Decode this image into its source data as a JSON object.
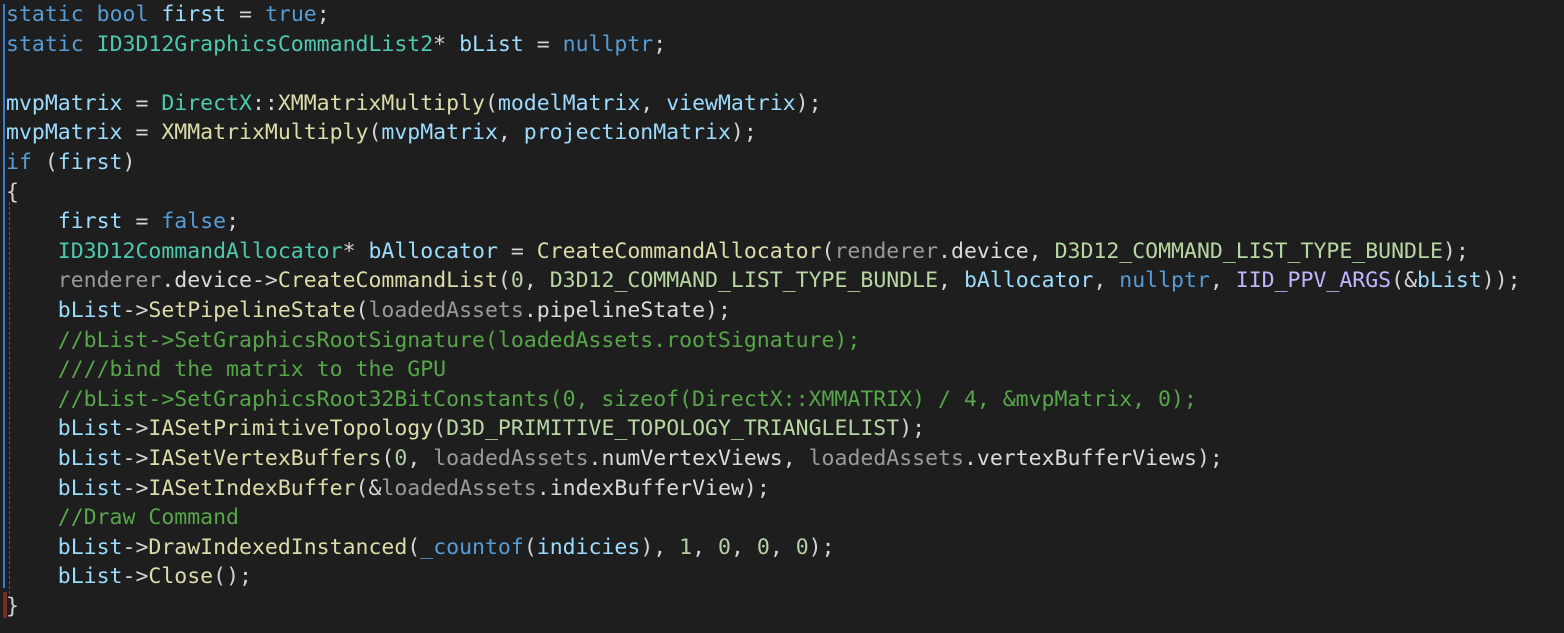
{
  "editor": {
    "language": "cpp",
    "theme": "dark",
    "colors": {
      "background": "#1e1e1e",
      "keyword": "#569cd6",
      "type": "#4ec9b0",
      "function": "#dcdcaa",
      "variable": "#9cdcfe",
      "comment": "#57a64a",
      "number": "#b5cea8",
      "macro": "#beb7ff",
      "margin_change_marker": "#3a7bd5"
    },
    "lines": [
      [
        [
          "kw",
          "static"
        ],
        [
          "op",
          " "
        ],
        [
          "kw",
          "bool"
        ],
        [
          "op",
          " "
        ],
        [
          "var",
          "first"
        ],
        [
          "op",
          " = "
        ],
        [
          "kw",
          "true"
        ],
        [
          "op",
          ";"
        ]
      ],
      [
        [
          "kw",
          "static"
        ],
        [
          "op",
          " "
        ],
        [
          "ty",
          "ID3D12GraphicsCommandList2"
        ],
        [
          "op",
          "* "
        ],
        [
          "var",
          "bList"
        ],
        [
          "op",
          " = "
        ],
        [
          "kw",
          "nullptr"
        ],
        [
          "op",
          ";"
        ]
      ],
      [],
      [
        [
          "var",
          "mvpMatrix"
        ],
        [
          "op",
          " = "
        ],
        [
          "ty",
          "DirectX"
        ],
        [
          "op",
          "::"
        ],
        [
          "fn",
          "XMMatrixMultiply"
        ],
        [
          "op",
          "("
        ],
        [
          "var",
          "modelMatrix"
        ],
        [
          "op",
          ", "
        ],
        [
          "var",
          "viewMatrix"
        ],
        [
          "op",
          ");"
        ]
      ],
      [
        [
          "var",
          "mvpMatrix"
        ],
        [
          "op",
          " = "
        ],
        [
          "fn",
          "XMMatrixMultiply"
        ],
        [
          "op",
          "("
        ],
        [
          "var",
          "mvpMatrix"
        ],
        [
          "op",
          ", "
        ],
        [
          "var",
          "projectionMatrix"
        ],
        [
          "op",
          ");"
        ]
      ],
      [
        [
          "kw",
          "if"
        ],
        [
          "op",
          " ("
        ],
        [
          "var",
          "first"
        ],
        [
          "op",
          ")"
        ]
      ],
      [
        [
          "op",
          "{"
        ]
      ],
      [
        [
          "op",
          "    "
        ],
        [
          "var",
          "first"
        ],
        [
          "op",
          " = "
        ],
        [
          "kw",
          "false"
        ],
        [
          "op",
          ";"
        ]
      ],
      [
        [
          "op",
          "    "
        ],
        [
          "ty",
          "ID3D12CommandAllocator"
        ],
        [
          "op",
          "* "
        ],
        [
          "var",
          "bAllocator"
        ],
        [
          "op",
          " = "
        ],
        [
          "fn",
          "CreateCommandAllocator"
        ],
        [
          "op",
          "("
        ],
        [
          "dim",
          "renderer"
        ],
        [
          "op",
          "."
        ],
        [
          "mem",
          "device"
        ],
        [
          "op",
          ", "
        ],
        [
          "enum",
          "D3D12_COMMAND_LIST_TYPE_BUNDLE"
        ],
        [
          "op",
          ");"
        ]
      ],
      [
        [
          "op",
          "    "
        ],
        [
          "dim",
          "renderer"
        ],
        [
          "op",
          "."
        ],
        [
          "mem",
          "device"
        ],
        [
          "op",
          "->"
        ],
        [
          "fn",
          "CreateCommandList"
        ],
        [
          "op",
          "("
        ],
        [
          "num",
          "0"
        ],
        [
          "op",
          ", "
        ],
        [
          "enum",
          "D3D12_COMMAND_LIST_TYPE_BUNDLE"
        ],
        [
          "op",
          ", "
        ],
        [
          "var",
          "bAllocator"
        ],
        [
          "op",
          ", "
        ],
        [
          "kw",
          "nullptr"
        ],
        [
          "op",
          ", "
        ],
        [
          "mac",
          "IID_PPV_ARGS"
        ],
        [
          "op",
          "(&"
        ],
        [
          "var",
          "bList"
        ],
        [
          "op",
          "));"
        ]
      ],
      [
        [
          "op",
          "    "
        ],
        [
          "var",
          "bList"
        ],
        [
          "op",
          "->"
        ],
        [
          "fn",
          "SetPipelineState"
        ],
        [
          "op",
          "("
        ],
        [
          "dim",
          "loadedAssets"
        ],
        [
          "op",
          "."
        ],
        [
          "mem",
          "pipelineState"
        ],
        [
          "op",
          ");"
        ]
      ],
      [
        [
          "op",
          "    "
        ],
        [
          "cm",
          "//bList->SetGraphicsRootSignature(loadedAssets.rootSignature);"
        ]
      ],
      [
        [
          "op",
          "    "
        ],
        [
          "cm",
          "////bind the matrix to the GPU"
        ]
      ],
      [
        [
          "op",
          "    "
        ],
        [
          "cm",
          "//bList->SetGraphicsRoot32BitConstants(0, sizeof(DirectX::XMMATRIX) / 4, &mvpMatrix, 0);"
        ]
      ],
      [
        [
          "op",
          "    "
        ],
        [
          "var",
          "bList"
        ],
        [
          "op",
          "->"
        ],
        [
          "fn",
          "IASetPrimitiveTopology"
        ],
        [
          "op",
          "("
        ],
        [
          "enum",
          "D3D_PRIMITIVE_TOPOLOGY_TRIANGLELIST"
        ],
        [
          "op",
          ");"
        ]
      ],
      [
        [
          "op",
          "    "
        ],
        [
          "var",
          "bList"
        ],
        [
          "op",
          "->"
        ],
        [
          "fn",
          "IASetVertexBuffers"
        ],
        [
          "op",
          "("
        ],
        [
          "num",
          "0"
        ],
        [
          "op",
          ", "
        ],
        [
          "dim",
          "loadedAssets"
        ],
        [
          "op",
          "."
        ],
        [
          "mem",
          "numVertexViews"
        ],
        [
          "op",
          ", "
        ],
        [
          "dim",
          "loadedAssets"
        ],
        [
          "op",
          "."
        ],
        [
          "mem",
          "vertexBufferViews"
        ],
        [
          "op",
          ");"
        ]
      ],
      [
        [
          "op",
          "    "
        ],
        [
          "var",
          "bList"
        ],
        [
          "op",
          "->"
        ],
        [
          "fn",
          "IASetIndexBuffer"
        ],
        [
          "op",
          "(&"
        ],
        [
          "dim",
          "loadedAssets"
        ],
        [
          "op",
          "."
        ],
        [
          "mem",
          "indexBufferView"
        ],
        [
          "op",
          ");"
        ]
      ],
      [
        [
          "op",
          "    "
        ],
        [
          "cm",
          "//Draw Command"
        ]
      ],
      [
        [
          "op",
          "    "
        ],
        [
          "var",
          "bList"
        ],
        [
          "op",
          "->"
        ],
        [
          "fn",
          "DrawIndexedInstanced"
        ],
        [
          "op",
          "("
        ],
        [
          "kw",
          "_countof"
        ],
        [
          "op",
          "("
        ],
        [
          "var",
          "indicies"
        ],
        [
          "op",
          "), "
        ],
        [
          "num",
          "1"
        ],
        [
          "op",
          ", "
        ],
        [
          "num",
          "0"
        ],
        [
          "op",
          ", "
        ],
        [
          "num",
          "0"
        ],
        [
          "op",
          ", "
        ],
        [
          "num",
          "0"
        ],
        [
          "op",
          ");"
        ]
      ],
      [
        [
          "op",
          "    "
        ],
        [
          "var",
          "bList"
        ],
        [
          "op",
          "->"
        ],
        [
          "fn",
          "Close"
        ],
        [
          "op",
          "();"
        ]
      ],
      [
        [
          "op",
          "}"
        ]
      ]
    ]
  }
}
